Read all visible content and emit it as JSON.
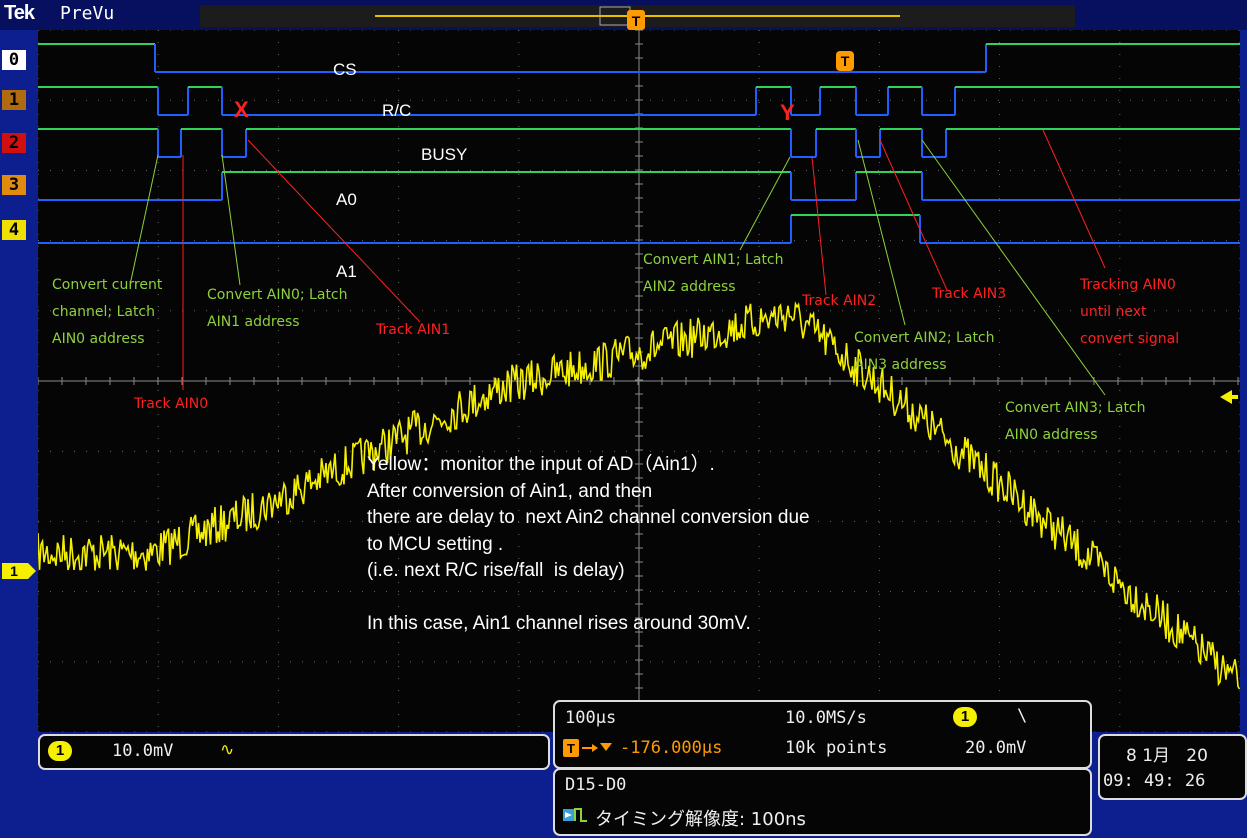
{
  "header": {
    "brand": "Tek",
    "mode": "PreVu",
    "trigger_marker": "T"
  },
  "channels": [
    {
      "tag": "0",
      "bg": "#ffffff",
      "fg": "#000000"
    },
    {
      "tag": "1",
      "bg": "#b06a10",
      "fg": "#000000"
    },
    {
      "tag": "2",
      "bg": "#d01010",
      "fg": "#000000"
    },
    {
      "tag": "3",
      "bg": "#e08a10",
      "fg": "#000000"
    },
    {
      "tag": "4",
      "bg": "#f0e000",
      "fg": "#000000"
    }
  ],
  "signal_labels": {
    "cs": "CS",
    "rc": "R/C",
    "busy": "BUSY",
    "a0": "A0",
    "a1": "A1"
  },
  "markers": {
    "x": "X",
    "y": "Y",
    "trigger": "T"
  },
  "annotations": {
    "convert_current": "Convert current\nchannel; Latch\nAIN0 address",
    "convert_ain0": "Convert AIN0; Latch\nAIN1 address",
    "track_ain0": "Track AIN0",
    "track_ain1": "Track AIN1",
    "convert_ain1": "Convert AIN1; Latch\nAIN2 address",
    "track_ain2": "Track AIN2",
    "track_ain3": "Track AIN3",
    "convert_ain2": "Convert AIN2; Latch\nAIN3 address",
    "convert_ain3": "Convert AIN3; Latch\nAIN0 address",
    "tracking_ain0": "Tracking AIN0\nuntil next\nconvert signal"
  },
  "note": "Yellow：monitor the input of AD（Ain1）.\nAfter conversion of Ain1, and then\nthere are delay to  next Ain2 channel conversion due\nto MCU setting .\n(i.e. next R/C rise/fall  is delay)\n\nIn this case, Ain1 channel rises around 30mV.",
  "ch1_marker": "1",
  "status": {
    "ch1_badge": "1",
    "ch1_scale": "10.0mV",
    "ch1_coupling": "∿",
    "timebase": "100µs",
    "sample_rate": "10.0MS/s",
    "trig_badge": "1",
    "trig_slope": "\\",
    "trig_position": "-176.000µs",
    "record_length": "10k points",
    "trig_level": "20.0mV",
    "date": "8 1月   20",
    "time": "09: 49: 26",
    "digital_group": "D15-D0",
    "timing_resolution": "タイミング解像度: 100ns"
  },
  "colors": {
    "yellow": "#f5f000",
    "green": "#2fd35a",
    "blue": "#1f5fff",
    "annot_green": "#8dd13c",
    "annot_red": "#ff2020"
  }
}
